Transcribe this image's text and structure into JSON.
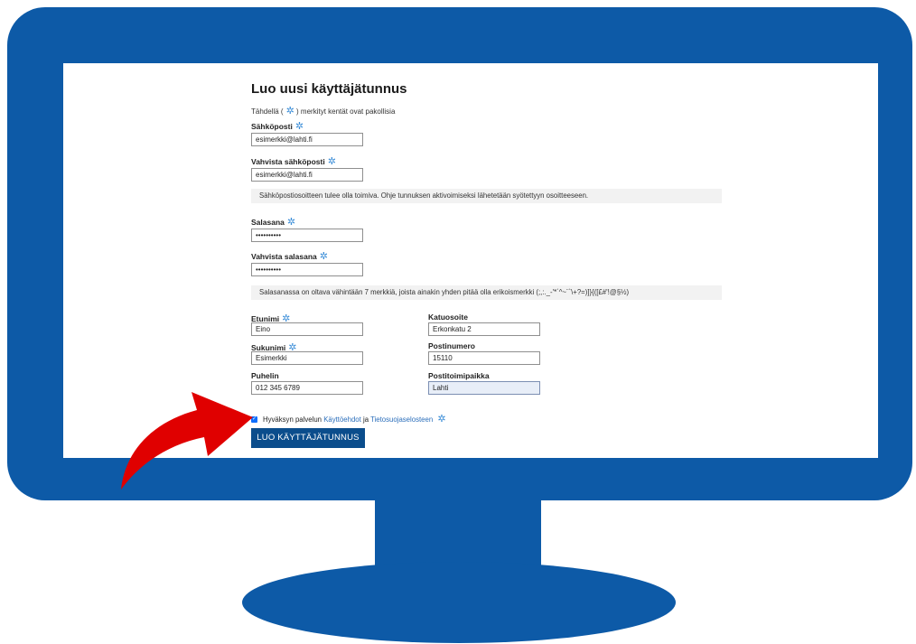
{
  "form": {
    "title": "Luo uusi käyttäjätunnus",
    "required_note_prefix": "Tähdellä (",
    "required_note_suffix": ") merkityt kentät ovat pakollisia",
    "required_marker": "✲",
    "email": {
      "label": "Sähköposti",
      "value": "esimerkki@lahti.fi"
    },
    "email_confirm": {
      "label": "Vahvista sähköposti",
      "value": "esimerkki@lahti.fi"
    },
    "email_info": "Sähköpostiosoitteen tulee olla toimiva. Ohje tunnuksen aktivoimiseksi lähetetään syötettyyn osoitteeseen.",
    "password": {
      "label": "Salasana",
      "value": "••••••••••"
    },
    "password_confirm": {
      "label": "Vahvista salasana",
      "value": "••••••••••"
    },
    "password_info": "Salasanassa on oltava vähintään 7 merkkiä, joista ainakin yhden pitää olla erikoismerkki (;,:._-'*´^~¨`\\+?=)]}{([£#'!@§½)",
    "first_name": {
      "label": "Etunimi",
      "value": "Eino"
    },
    "last_name": {
      "label": "Sukunimi",
      "value": "Esimerkki"
    },
    "phone": {
      "label": "Puhelin",
      "value": "012 345 6789"
    },
    "street": {
      "label": "Katuosoite",
      "value": "Erkonkatu 2"
    },
    "postal_code": {
      "label": "Postinumero",
      "value": "15110"
    },
    "city": {
      "label": "Postitoimipaikka",
      "value": "Lahti"
    },
    "consent": {
      "checked": true,
      "prefix": "Hyväksyn palvelun",
      "terms_link": "Käyttöehdot",
      "and": "ja",
      "privacy_link": "Tietosuojaselosteen"
    },
    "submit_label": "LUO KÄYTTÄJÄTUNNUS"
  },
  "colors": {
    "monitor": "#0d5aa7",
    "arrow": "#e00000",
    "button": "#0b4d8c",
    "link": "#2c6fbb",
    "required_star": "#3c8ed8"
  }
}
